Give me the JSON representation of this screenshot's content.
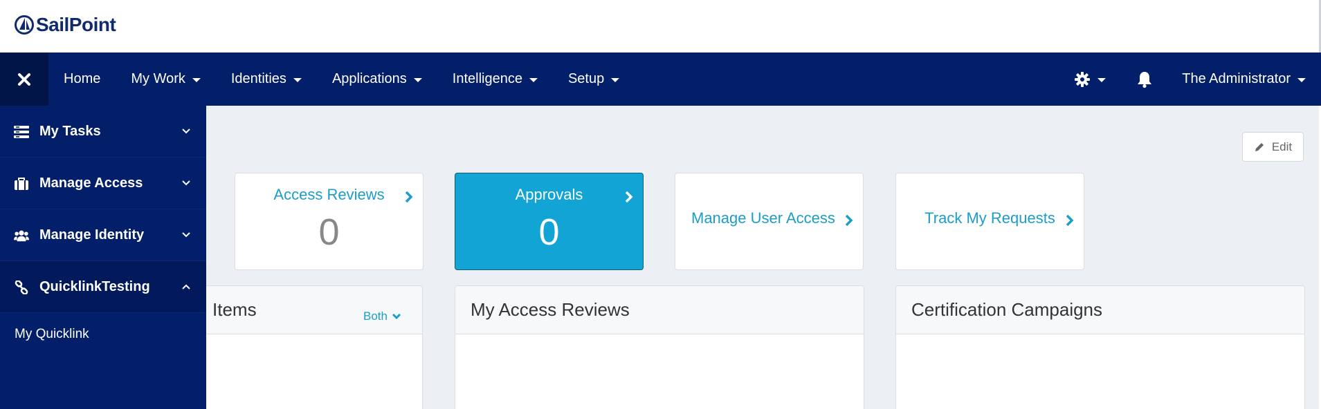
{
  "brand": {
    "name": "SailPoint"
  },
  "nav": {
    "items": [
      {
        "label": "Home",
        "caret": false
      },
      {
        "label": "My Work",
        "caret": true
      },
      {
        "label": "Identities",
        "caret": true
      },
      {
        "label": "Applications",
        "caret": true
      },
      {
        "label": "Intelligence",
        "caret": true
      },
      {
        "label": "Setup",
        "caret": true
      }
    ],
    "user": "The Administrator",
    "icons": {
      "close": "close-icon",
      "settings": "gear-icon",
      "notifications": "bell-icon"
    }
  },
  "sidebar": {
    "items": [
      {
        "label": "My Tasks",
        "icon": "tasks-icon",
        "expanded": false
      },
      {
        "label": "Manage Access",
        "icon": "briefcase-icon",
        "expanded": false
      },
      {
        "label": "Manage Identity",
        "icon": "users-icon",
        "expanded": false
      },
      {
        "label": "QuicklinkTesting",
        "icon": "link-icon",
        "expanded": true
      }
    ],
    "subitems": [
      {
        "label": "My Quicklink"
      }
    ]
  },
  "toolbar": {
    "edit_label": "Edit"
  },
  "tiles": [
    {
      "title": "Access Reviews",
      "count": "0",
      "active": false
    },
    {
      "title": "Approvals",
      "count": "0",
      "active": true
    },
    {
      "title": "Manage User Access"
    },
    {
      "title": "Track My Requests"
    }
  ],
  "panels": [
    {
      "title": "Items",
      "filter": "Both"
    },
    {
      "title": "My Access Reviews"
    },
    {
      "title": "Certification Campaigns"
    }
  ],
  "colors": {
    "nav_bg": "#031f69",
    "accent": "#11a4d4",
    "link": "#1a9dc9",
    "page_bg": "#eceff3"
  }
}
